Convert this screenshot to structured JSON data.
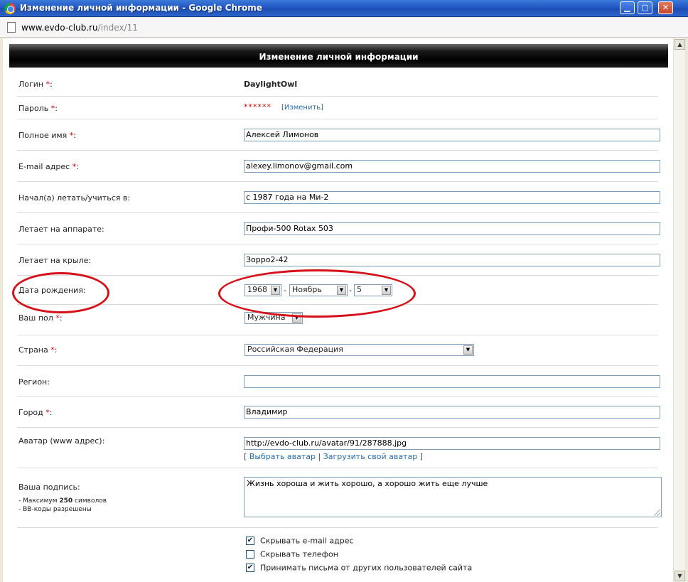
{
  "window": {
    "title": "Изменение личной информации - Google Chrome",
    "url_host": "www.evdo-club.ru",
    "url_path": "/index/11",
    "minimize": "▁",
    "maximize": "▢",
    "close": "✕"
  },
  "page": {
    "header": "Изменение личной информации"
  },
  "form": {
    "login_label": "Логин",
    "login_value": "DaylightOwl",
    "password_label": "Пароль",
    "password_value": "******",
    "password_change": "Изменить",
    "fullname_label": "Полное имя",
    "fullname_value": "Алексей Лимонов",
    "email_label": "E-mail адрес",
    "email_value": "alexey.limonov@gmail.com",
    "started_label": "Начал(а) летать/учиться в:",
    "started_value": "с 1987 года на Ми-2",
    "aircraft_label": "Летает на аппарате:",
    "aircraft_value": "Профи-500 Rotax 503",
    "wing_label": "Летает на крыле:",
    "wing_value": "Зорро2-42",
    "birth_label": "Дата рождения:",
    "birth_year": "1968",
    "birth_month": "Ноябрь",
    "birth_day": "5",
    "gender_label": "Ваш пол",
    "gender_value": "Мужчина",
    "country_label": "Страна",
    "country_value": "Российская Федерация",
    "region_label": "Регион:",
    "region_value": "",
    "city_label": "Город",
    "city_value": "Владимир",
    "avatar_label": "Аватар (www адрес):",
    "avatar_value": "http://evdo-club.ru/avatar/91/287888.jpg",
    "avatar_choose": "Выбрать аватар",
    "avatar_upload": "Загрузить свой аватар",
    "signature_label": "Ваша подпись:",
    "signature_hint_prefix": "- Максимум ",
    "signature_hint_max": "250",
    "signature_hint_suffix": " символов",
    "signature_hint_bb": "- BB-коды разрешены",
    "signature_value": "Жизнь хороша и жить хорошо, а хорошо жить еще лучше",
    "hide_email_label": "Скрывать e-mail адрес",
    "hide_email_checked": "✔",
    "hide_phone_label": "Скрывать телефон",
    "accept_mail_label": "Принимать письма от других пользователей сайта",
    "accept_mail_checked": "✔"
  },
  "colors": {
    "required_star": "#d40000",
    "link": "#2a6ea8",
    "annotation": "#d6101a"
  }
}
